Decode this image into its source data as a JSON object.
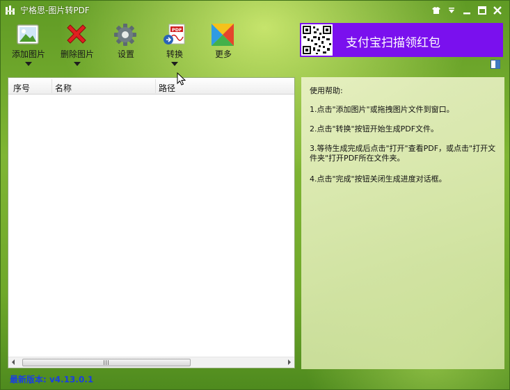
{
  "window": {
    "title": "宁格思-图片转PDF",
    "controls": [
      "skin-icon",
      "menu-icon",
      "minimize-icon",
      "maximize-icon",
      "close-icon"
    ]
  },
  "toolbar": {
    "add_label": "添加图片",
    "delete_label": "删除图片",
    "settings_label": "设置",
    "convert_label": "转换",
    "more_label": "更多"
  },
  "banner": {
    "text": "支付宝扫描领红包",
    "color": "#7a10ee"
  },
  "table": {
    "columns": [
      "序号",
      "名称",
      "路径"
    ],
    "rows": []
  },
  "help": {
    "title": "使用帮助:",
    "steps": [
      "1.点击\"添加图片\"或拖拽图片文件到窗口。",
      "2.点击\"转换\"按钮开始生成PDF文件。",
      "3.等待生成完成后点击\"打开\"查看PDF，或点击\"打开文件夹\"打开PDF所在文件夹。",
      "4.点击\"完成\"按钮关闭生成进度对话框。"
    ]
  },
  "footer": {
    "version": "最新版本: v4.13.0.1",
    "version_color": "#1a3fe0"
  }
}
